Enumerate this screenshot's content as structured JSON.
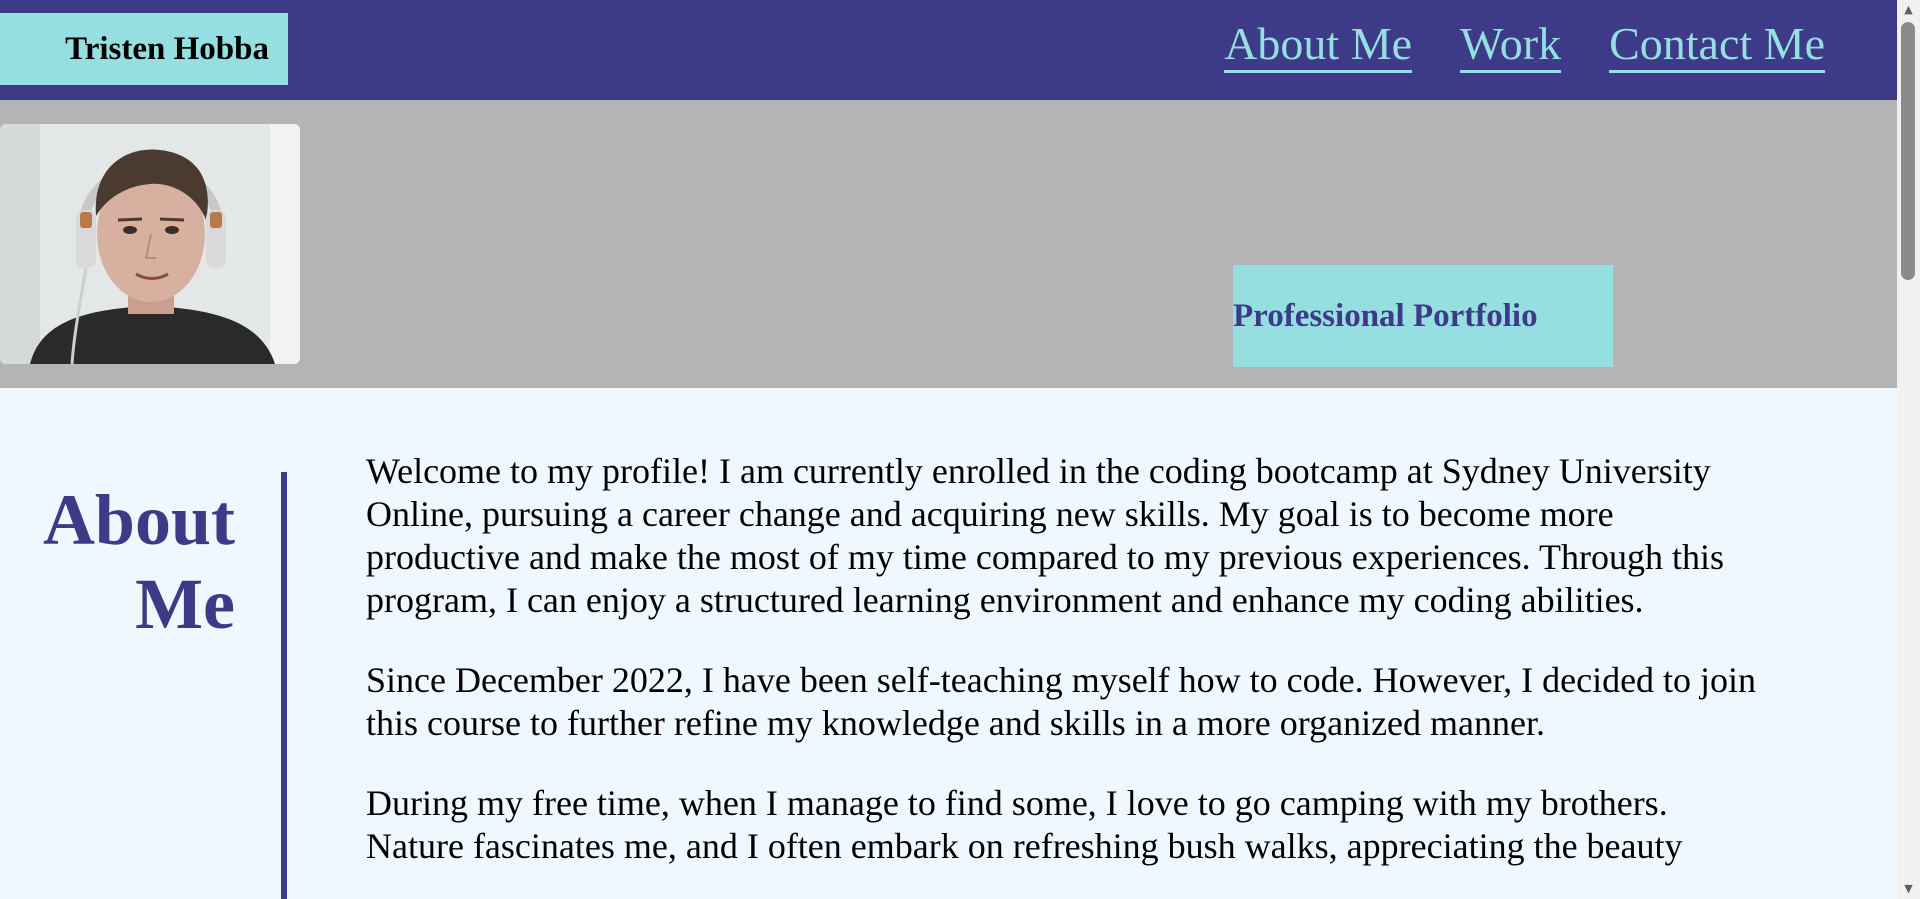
{
  "header": {
    "brand": "Tristen Hobba",
    "nav": [
      {
        "label": "About Me"
      },
      {
        "label": "Work"
      },
      {
        "label": "Contact Me"
      }
    ]
  },
  "hero": {
    "tagline": "Professional Portfolio"
  },
  "about": {
    "heading_line1": "About",
    "heading_line2": "Me",
    "paragraphs": [
      "Welcome to my profile! I am currently enrolled in the coding bootcamp at Sydney University Online, pursuing a career change and acquiring new skills. My goal is to become more productive and make the most of my time compared to my previous experiences. Through this program, I can enjoy a structured learning environment and enhance my coding abilities.",
      "Since December 2022, I have been self-teaching myself how to code. However, I decided to join this course to further refine my knowledge and skills in a more organized manner.",
      "During my free time, when I manage to find some, I love to go camping with my brothers. Nature fascinates me, and I often embark on refreshing bush walks, appreciating the beauty"
    ]
  },
  "colors": {
    "header_bg": "#3d3b88",
    "accent": "#96dfe1",
    "hero_bg": "#b4b4b6",
    "page_bg": "#f0f8ff"
  }
}
